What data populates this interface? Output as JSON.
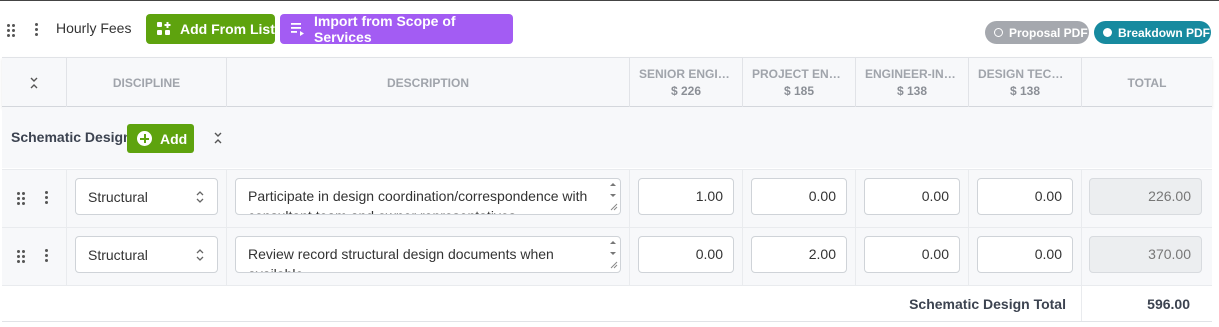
{
  "toolbar": {
    "title": "Hourly Fees",
    "add_from_list_label": "Add From List",
    "import_label": "Import from Scope of Services",
    "proposal_pdf_label": "Proposal PDF",
    "breakdown_pdf_label": "Breakdown PDF"
  },
  "table": {
    "columns": {
      "discipline": "DISCIPLINE",
      "description": "DESCRIPTION",
      "roles": [
        {
          "name": "SENIOR ENGINEER",
          "rate": "$ 226"
        },
        {
          "name": "PROJECT ENGINEER",
          "rate": "$ 185"
        },
        {
          "name": "ENGINEER-IN-TRAINING",
          "rate": "$ 138"
        },
        {
          "name": "DESIGN TECHNICIAN",
          "rate": "$ 138"
        }
      ],
      "total": "TOTAL"
    },
    "section": {
      "title": "Schematic Design",
      "add_label": "Add",
      "rows": [
        {
          "discipline": "Structural",
          "description": "Participate in design coordination/correspondence with consultant team and owner representatives",
          "hours": [
            "1.00",
            "0.00",
            "0.00",
            "0.00"
          ],
          "total": "226.00"
        },
        {
          "discipline": "Structural",
          "description": "Review record structural design documents when available",
          "hours": [
            "0.00",
            "2.00",
            "0.00",
            "0.00"
          ],
          "total": "370.00"
        }
      ],
      "total_label": "Schematic Design Total",
      "total_value": "596.00"
    }
  },
  "colors": {
    "green": "#5ea30e",
    "purple": "#a35cf3",
    "gray_pill": "#a5a8ae",
    "teal_pill": "#178a9f"
  },
  "icons": [
    "drag-handle-icon",
    "kebab-menu-icon",
    "grid-add-icon",
    "list-import-icon",
    "collapse-icon",
    "plus-circle-icon",
    "chevron-updown-icon"
  ]
}
